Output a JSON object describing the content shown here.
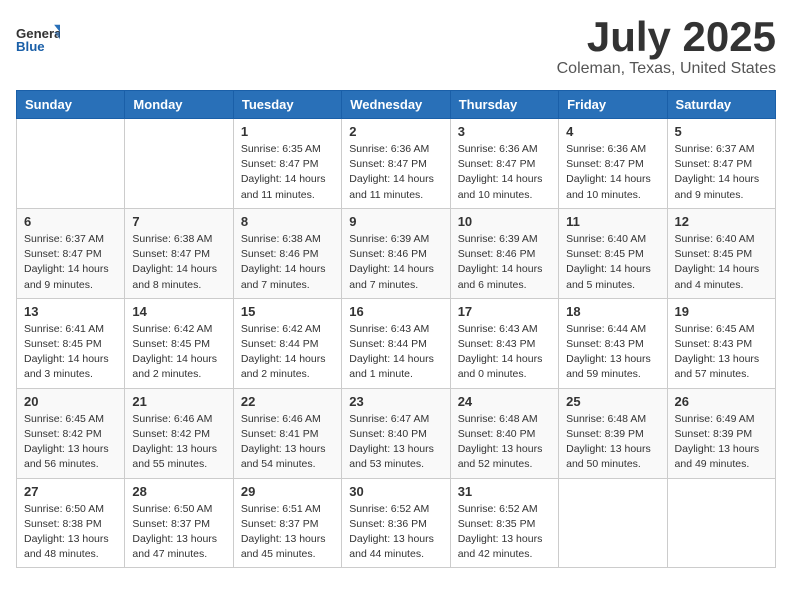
{
  "header": {
    "logo_general": "General",
    "logo_blue": "Blue",
    "title": "July 2025",
    "location": "Coleman, Texas, United States"
  },
  "weekdays": [
    "Sunday",
    "Monday",
    "Tuesday",
    "Wednesday",
    "Thursday",
    "Friday",
    "Saturday"
  ],
  "weeks": [
    [
      {
        "day": "",
        "info": ""
      },
      {
        "day": "",
        "info": ""
      },
      {
        "day": "1",
        "info": "Sunrise: 6:35 AM\nSunset: 8:47 PM\nDaylight: 14 hours and 11 minutes."
      },
      {
        "day": "2",
        "info": "Sunrise: 6:36 AM\nSunset: 8:47 PM\nDaylight: 14 hours and 11 minutes."
      },
      {
        "day": "3",
        "info": "Sunrise: 6:36 AM\nSunset: 8:47 PM\nDaylight: 14 hours and 10 minutes."
      },
      {
        "day": "4",
        "info": "Sunrise: 6:36 AM\nSunset: 8:47 PM\nDaylight: 14 hours and 10 minutes."
      },
      {
        "day": "5",
        "info": "Sunrise: 6:37 AM\nSunset: 8:47 PM\nDaylight: 14 hours and 9 minutes."
      }
    ],
    [
      {
        "day": "6",
        "info": "Sunrise: 6:37 AM\nSunset: 8:47 PM\nDaylight: 14 hours and 9 minutes."
      },
      {
        "day": "7",
        "info": "Sunrise: 6:38 AM\nSunset: 8:47 PM\nDaylight: 14 hours and 8 minutes."
      },
      {
        "day": "8",
        "info": "Sunrise: 6:38 AM\nSunset: 8:46 PM\nDaylight: 14 hours and 7 minutes."
      },
      {
        "day": "9",
        "info": "Sunrise: 6:39 AM\nSunset: 8:46 PM\nDaylight: 14 hours and 7 minutes."
      },
      {
        "day": "10",
        "info": "Sunrise: 6:39 AM\nSunset: 8:46 PM\nDaylight: 14 hours and 6 minutes."
      },
      {
        "day": "11",
        "info": "Sunrise: 6:40 AM\nSunset: 8:45 PM\nDaylight: 14 hours and 5 minutes."
      },
      {
        "day": "12",
        "info": "Sunrise: 6:40 AM\nSunset: 8:45 PM\nDaylight: 14 hours and 4 minutes."
      }
    ],
    [
      {
        "day": "13",
        "info": "Sunrise: 6:41 AM\nSunset: 8:45 PM\nDaylight: 14 hours and 3 minutes."
      },
      {
        "day": "14",
        "info": "Sunrise: 6:42 AM\nSunset: 8:45 PM\nDaylight: 14 hours and 2 minutes."
      },
      {
        "day": "15",
        "info": "Sunrise: 6:42 AM\nSunset: 8:44 PM\nDaylight: 14 hours and 2 minutes."
      },
      {
        "day": "16",
        "info": "Sunrise: 6:43 AM\nSunset: 8:44 PM\nDaylight: 14 hours and 1 minute."
      },
      {
        "day": "17",
        "info": "Sunrise: 6:43 AM\nSunset: 8:43 PM\nDaylight: 14 hours and 0 minutes."
      },
      {
        "day": "18",
        "info": "Sunrise: 6:44 AM\nSunset: 8:43 PM\nDaylight: 13 hours and 59 minutes."
      },
      {
        "day": "19",
        "info": "Sunrise: 6:45 AM\nSunset: 8:43 PM\nDaylight: 13 hours and 57 minutes."
      }
    ],
    [
      {
        "day": "20",
        "info": "Sunrise: 6:45 AM\nSunset: 8:42 PM\nDaylight: 13 hours and 56 minutes."
      },
      {
        "day": "21",
        "info": "Sunrise: 6:46 AM\nSunset: 8:42 PM\nDaylight: 13 hours and 55 minutes."
      },
      {
        "day": "22",
        "info": "Sunrise: 6:46 AM\nSunset: 8:41 PM\nDaylight: 13 hours and 54 minutes."
      },
      {
        "day": "23",
        "info": "Sunrise: 6:47 AM\nSunset: 8:40 PM\nDaylight: 13 hours and 53 minutes."
      },
      {
        "day": "24",
        "info": "Sunrise: 6:48 AM\nSunset: 8:40 PM\nDaylight: 13 hours and 52 minutes."
      },
      {
        "day": "25",
        "info": "Sunrise: 6:48 AM\nSunset: 8:39 PM\nDaylight: 13 hours and 50 minutes."
      },
      {
        "day": "26",
        "info": "Sunrise: 6:49 AM\nSunset: 8:39 PM\nDaylight: 13 hours and 49 minutes."
      }
    ],
    [
      {
        "day": "27",
        "info": "Sunrise: 6:50 AM\nSunset: 8:38 PM\nDaylight: 13 hours and 48 minutes."
      },
      {
        "day": "28",
        "info": "Sunrise: 6:50 AM\nSunset: 8:37 PM\nDaylight: 13 hours and 47 minutes."
      },
      {
        "day": "29",
        "info": "Sunrise: 6:51 AM\nSunset: 8:37 PM\nDaylight: 13 hours and 45 minutes."
      },
      {
        "day": "30",
        "info": "Sunrise: 6:52 AM\nSunset: 8:36 PM\nDaylight: 13 hours and 44 minutes."
      },
      {
        "day": "31",
        "info": "Sunrise: 6:52 AM\nSunset: 8:35 PM\nDaylight: 13 hours and 42 minutes."
      },
      {
        "day": "",
        "info": ""
      },
      {
        "day": "",
        "info": ""
      }
    ]
  ]
}
